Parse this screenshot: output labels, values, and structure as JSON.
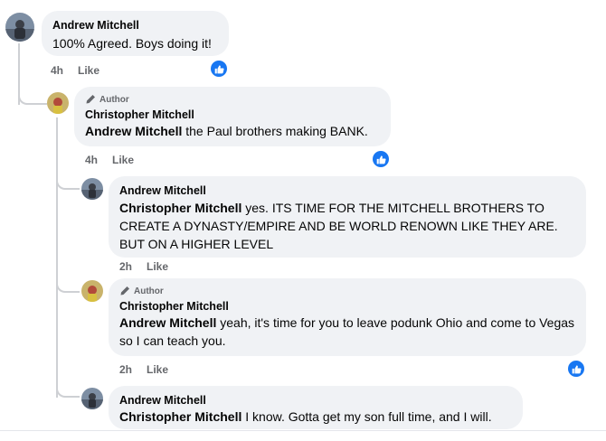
{
  "comments": [
    {
      "author": "Andrew Mitchell",
      "text": "100% Agreed. Boys doing it!",
      "time": "4h",
      "like_label": "Like"
    },
    {
      "author_badge": "Author",
      "author": "Christopher Mitchell",
      "mention": "Andrew Mitchell",
      "text": " the Paul brothers making BANK.",
      "time": "4h",
      "like_label": "Like"
    },
    {
      "author": "Andrew Mitchell",
      "mention": "Christopher Mitchell",
      "text": " yes. ITS TIME FOR THE MITCHELL BROTHERS TO CREATE A DYNASTY/EMPIRE AND BE WORLD RENOWN LIKE THEY ARE. BUT ON A HIGHER LEVEL",
      "time": "2h",
      "like_label": "Like"
    },
    {
      "author_badge": "Author",
      "author": "Christopher Mitchell",
      "mention": "Andrew Mitchell",
      "text": " yeah, it's time for you to leave podunk Ohio and come to Vegas so I can teach you.",
      "time": "2h",
      "like_label": "Like"
    },
    {
      "author": "Andrew Mitchell",
      "mention": "Christopher Mitchell",
      "text": " I know. Gotta get my son full time, and I will."
    }
  ],
  "colors": {
    "bubble": "#f0f2f5",
    "like_blue": "#1877f2",
    "meta_gray": "#65676b",
    "thread_line": "#ced0d4"
  },
  "icons": {
    "reaction": "thumbs-up-icon",
    "author_badge": "pencil-icon"
  }
}
